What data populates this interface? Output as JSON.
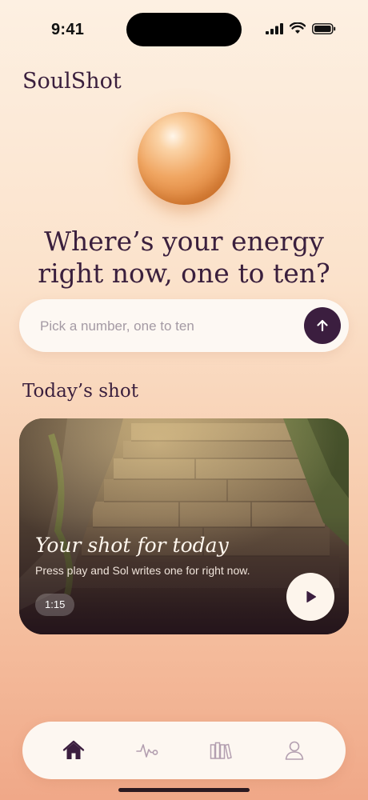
{
  "status": {
    "time": "9:41"
  },
  "app": {
    "title": "SoulShot"
  },
  "prompt": {
    "line1": "Where’s your energy",
    "line2": "right now, one to ten?"
  },
  "input": {
    "placeholder": "Pick a number, one to ten",
    "value": ""
  },
  "section": {
    "title": "Today’s shot"
  },
  "card": {
    "title": "Your shot for today",
    "subtitle": "Press play and Sol writes one for right now.",
    "duration": "1:15"
  },
  "tabs": [
    {
      "icon": "home-icon",
      "active": true
    },
    {
      "icon": "pulse-icon",
      "active": false
    },
    {
      "icon": "library-icon",
      "active": false
    },
    {
      "icon": "profile-icon",
      "active": false
    }
  ],
  "colors": {
    "accent": "#3b1e3f",
    "inactive_icon": "#b39fb0",
    "text": "#3a1f3d"
  }
}
